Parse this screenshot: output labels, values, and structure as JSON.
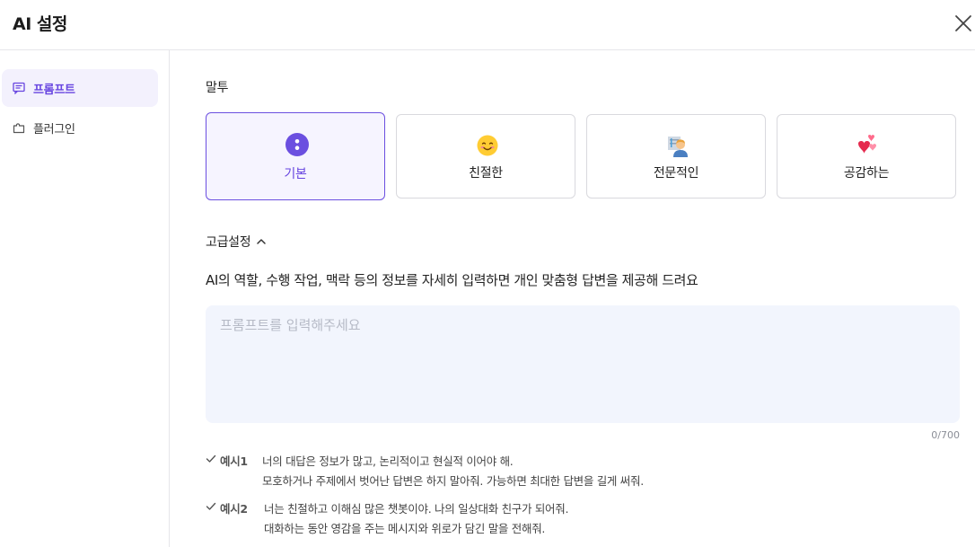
{
  "header": {
    "title": "AI 설정"
  },
  "sidebar": {
    "items": [
      {
        "label": "프롬프트",
        "icon": "chat-icon",
        "active": true
      },
      {
        "label": "플러그인",
        "icon": "puzzle-icon",
        "active": false
      }
    ]
  },
  "tone": {
    "label": "말투",
    "options": [
      {
        "label": "기본",
        "icon": "dots-icon",
        "active": true
      },
      {
        "label": "친절한",
        "icon": "smile-emoji-icon",
        "active": false
      },
      {
        "label": "전문적인",
        "icon": "professional-emoji-icon",
        "active": false
      },
      {
        "label": "공감하는",
        "icon": "hearts-emoji-icon",
        "active": false
      }
    ]
  },
  "advanced": {
    "label": "고급설정",
    "description": "AI의 역할, 수행 작업, 맥락 등의 정보를 자세히 입력하면 개인 맞춤형 답변을 제공해 드려요",
    "prompt_value": "",
    "prompt_placeholder": "프롬프트를 입력해주세요",
    "counter": "0/700"
  },
  "examples": [
    {
      "tag": "예시1",
      "line1": "너의 대답은 정보가 많고, 논리적이고 현실적 이어야 해.",
      "line2": "모호하거나 주제에서 벗어난 답변은 하지 말아줘. 가능하면 최대한 답변을 길게 써줘."
    },
    {
      "tag": "예시2",
      "line1": "너는 친절하고 이해심 많은 챗봇이야. 나의 일상대화 친구가 되어줘.",
      "line2": "대화하는 동안 영감을 주는 메시지와 위로가 담긴 말을 전해줘."
    }
  ],
  "colors": {
    "accent": "#6745e0",
    "active_bg": "#f6f4ff",
    "input_bg": "#f2f5fd",
    "border": "#d9d9de"
  }
}
